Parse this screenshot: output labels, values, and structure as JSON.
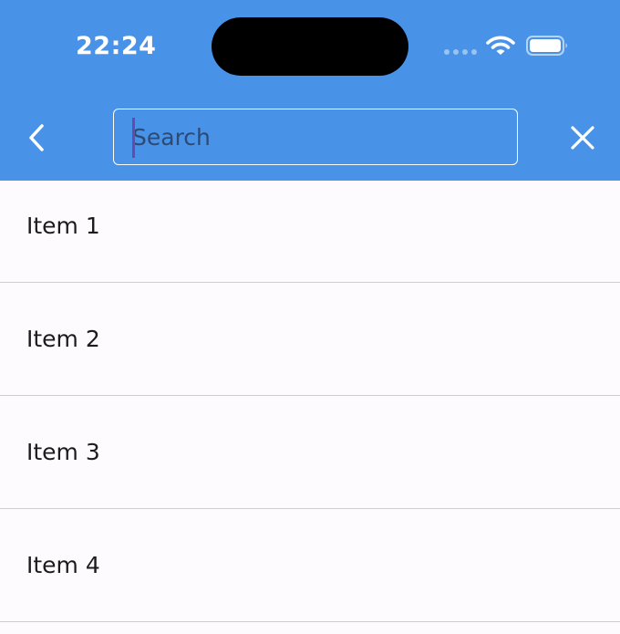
{
  "status_bar": {
    "time": "22:24"
  },
  "app_bar": {
    "background_color": "#4893e8",
    "back_icon": "chevron-left-icon",
    "close_icon": "close-icon",
    "search": {
      "placeholder": "Search",
      "value": ""
    }
  },
  "list": {
    "items": [
      {
        "label": "Item 1"
      },
      {
        "label": "Item 2"
      },
      {
        "label": "Item 3"
      },
      {
        "label": "Item 4"
      }
    ]
  }
}
